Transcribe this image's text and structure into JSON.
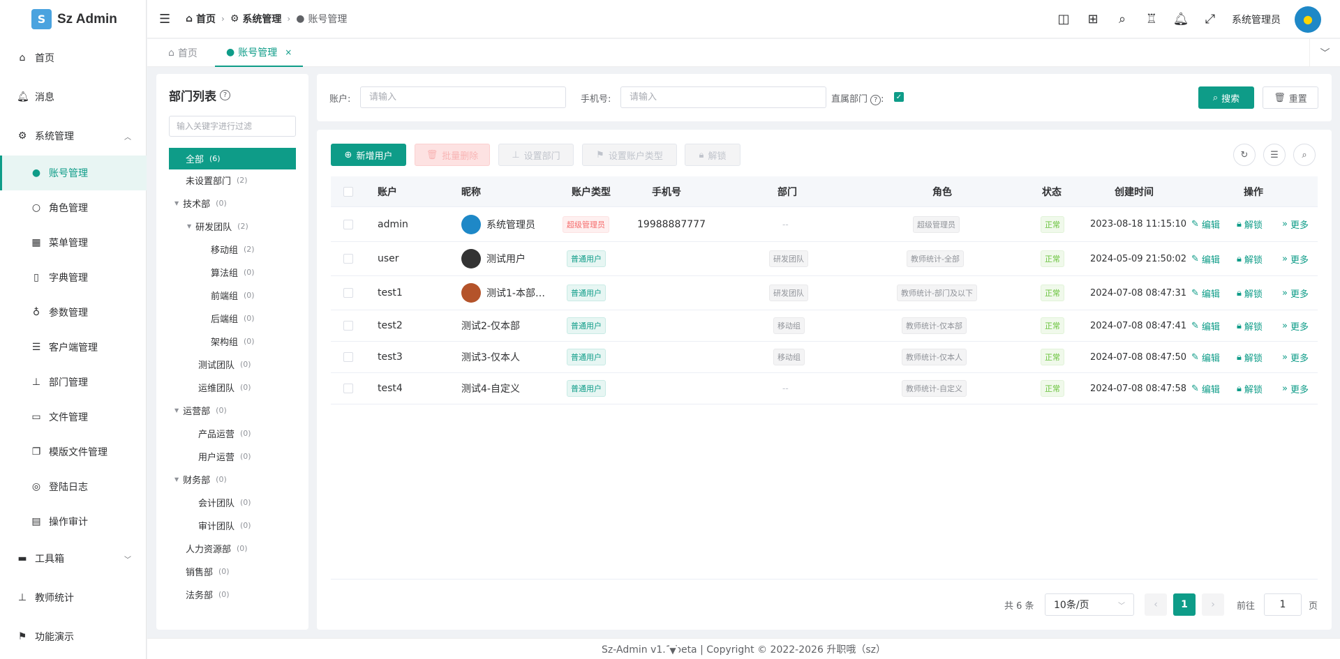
{
  "app": {
    "logo_letter": "S",
    "name": "Sz Admin"
  },
  "sidebar": {
    "items": [
      {
        "label": "首页",
        "icon": "home-icon"
      },
      {
        "label": "消息",
        "icon": "bell-icon"
      },
      {
        "label": "系统管理",
        "icon": "gear-icon"
      },
      {
        "label": "账号管理",
        "icon": "user-icon"
      },
      {
        "label": "角色管理",
        "icon": "user-outline-icon"
      },
      {
        "label": "菜单管理",
        "icon": "grid-icon"
      },
      {
        "label": "字典管理",
        "icon": "book-icon"
      },
      {
        "label": "参数管理",
        "icon": "param-icon"
      },
      {
        "label": "客户端管理",
        "icon": "sliders-icon"
      },
      {
        "label": "部门管理",
        "icon": "org-icon"
      },
      {
        "label": "文件管理",
        "icon": "briefcase-icon"
      },
      {
        "label": "模版文件管理",
        "icon": "files-icon"
      },
      {
        "label": "登陆日志",
        "icon": "location-icon"
      },
      {
        "label": "操作审计",
        "icon": "audit-icon"
      },
      {
        "label": "工具箱",
        "icon": "toolbox-icon"
      },
      {
        "label": "教师统计",
        "icon": "org-icon"
      },
      {
        "label": "功能演示",
        "icon": "flag-icon"
      }
    ]
  },
  "header": {
    "breadcrumb": [
      "首页",
      "系统管理",
      "账号管理"
    ],
    "username": "系统管理员"
  },
  "tabs": [
    {
      "label": "首页"
    },
    {
      "label": "账号管理",
      "close": "×"
    }
  ],
  "dept": {
    "title": "部门列表",
    "filter_placeholder": "输入关键字进行过滤",
    "nodes": [
      {
        "label": "全部",
        "count": "(6)"
      },
      {
        "label": "未设置部门",
        "count": "(2)"
      },
      {
        "label": "技术部",
        "count": "(0)"
      },
      {
        "label": "研发团队",
        "count": "(2)"
      },
      {
        "label": "移动组",
        "count": "(2)"
      },
      {
        "label": "算法组",
        "count": "(0)"
      },
      {
        "label": "前端组",
        "count": "(0)"
      },
      {
        "label": "后端组",
        "count": "(0)"
      },
      {
        "label": "架构组",
        "count": "(0)"
      },
      {
        "label": "测试团队",
        "count": "(0)"
      },
      {
        "label": "运维团队",
        "count": "(0)"
      },
      {
        "label": "运营部",
        "count": "(0)"
      },
      {
        "label": "产品运营",
        "count": "(0)"
      },
      {
        "label": "用户运营",
        "count": "(0)"
      },
      {
        "label": "财务部",
        "count": "(0)"
      },
      {
        "label": "会计团队",
        "count": "(0)"
      },
      {
        "label": "审计团队",
        "count": "(0)"
      },
      {
        "label": "人力资源部",
        "count": "(0)"
      },
      {
        "label": "销售部",
        "count": "(0)"
      },
      {
        "label": "法务部",
        "count": "(0)"
      }
    ]
  },
  "search": {
    "account_label": "账户:",
    "account_placeholder": "请输入",
    "phone_label": "手机号:",
    "phone_placeholder": "请输入",
    "direct_label": "直属部门",
    "direct_checked": true,
    "search_btn": "搜索",
    "reset_btn": "重置"
  },
  "toolbar": {
    "add": "新增用户",
    "batch_delete": "批量删除",
    "set_dept": "设置部门",
    "set_type": "设置账户类型",
    "unlock": "解锁"
  },
  "table": {
    "headers": [
      "账户",
      "昵称",
      "账户类型",
      "手机号",
      "部门",
      "角色",
      "状态",
      "创建时间",
      "操作"
    ],
    "rows": [
      {
        "account": "admin",
        "nickname": "系统管理员",
        "type": "超级管理员",
        "type_style": "red",
        "phone": "19988887777",
        "dept": "--",
        "role": "超级管理员",
        "status": "正常",
        "created": "2023-08-18 11:15:10"
      },
      {
        "account": "user",
        "nickname": "测试用户",
        "type": "普通用户",
        "type_style": "green",
        "phone": "",
        "dept": "研发团队",
        "role": "教师统计-全部",
        "status": "正常",
        "created": "2024-05-09 21:50:02"
      },
      {
        "account": "test1",
        "nickname": "测试1-本部…",
        "type": "普通用户",
        "type_style": "green",
        "phone": "",
        "dept": "研发团队",
        "role": "教师统计-部门及以下",
        "status": "正常",
        "created": "2024-07-08 08:47:31"
      },
      {
        "account": "test2",
        "nickname": "测试2-仅本部",
        "type": "普通用户",
        "type_style": "green",
        "phone": "",
        "dept": "移动组",
        "role": "教师统计-仅本部",
        "status": "正常",
        "created": "2024-07-08 08:47:41"
      },
      {
        "account": "test3",
        "nickname": "测试3-仅本人",
        "type": "普通用户",
        "type_style": "green",
        "phone": "",
        "dept": "移动组",
        "role": "教师统计-仅本人",
        "status": "正常",
        "created": "2024-07-08 08:47:50"
      },
      {
        "account": "test4",
        "nickname": "测试4-自定义",
        "type": "普通用户",
        "type_style": "green",
        "phone": "",
        "dept": "--",
        "role": "教师统计-自定义",
        "status": "正常",
        "created": "2024-07-08 08:47:58"
      }
    ],
    "actions": {
      "edit": "编辑",
      "unlock": "解锁",
      "more": "更多"
    }
  },
  "pagination": {
    "total": "共 6 条",
    "page_size": "10条/页",
    "current": "1",
    "goto_label": "前往",
    "goto_value": "1",
    "page_suffix": "页"
  },
  "footer": {
    "text": "Sz-Admin v1.1 beta | Copyright © 2022-2026 升职哦（sz）"
  },
  "colors": {
    "primary": "#0e9c88",
    "danger": "#f56c6c",
    "success": "#67c23a"
  }
}
